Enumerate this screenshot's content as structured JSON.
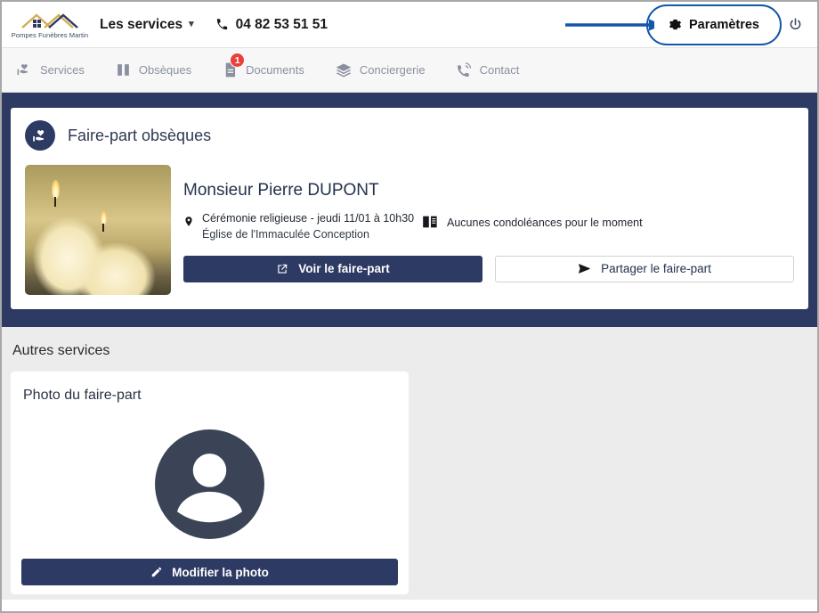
{
  "brand": {
    "logo_icon": "house-roofs-logo-icon",
    "logo_text": "Pompes Funèbres Martin",
    "colors": {
      "navy": "#2d3a63",
      "gold": "#d5ad54",
      "badge_red": "#e8413a",
      "annotation_blue": "#1257a8"
    }
  },
  "header": {
    "services_menu_label": "Les services",
    "chevron_icon": "chevron-down-icon",
    "phone_icon": "phone-icon",
    "phone_number": "04 82 53 51 51",
    "settings_label": "Paramètres",
    "settings_icon": "gear-icon",
    "power_icon": "power-icon",
    "annotation": {
      "arrow_icon": "arrow-right-annotation",
      "highlight": "ellipse-highlight"
    }
  },
  "nav": {
    "items": [
      {
        "label": "Services",
        "icon": "hand-heart-icon",
        "badge": null
      },
      {
        "label": "Obsèques",
        "icon": "open-book-icon",
        "badge": null
      },
      {
        "label": "Documents",
        "icon": "document-icon",
        "badge": "1"
      },
      {
        "label": "Conciergerie",
        "icon": "layers-icon",
        "badge": null
      },
      {
        "label": "Contact",
        "icon": "phone-signal-icon",
        "badge": null
      }
    ]
  },
  "main_card": {
    "icon": "hand-heart-circle-icon",
    "title": "Faire-part obsèques",
    "photo_alt": "candles-photo",
    "deceased_name": "Monsieur Pierre DUPONT",
    "ceremony": {
      "icon": "location-pin-icon",
      "line1": "Cérémonie religieuse - jeudi 11/01 à 10h30",
      "line2": "Église de l'Immaculée Conception"
    },
    "condolences": {
      "icon": "open-book-icon",
      "text": "Aucunes condoléances pour le moment"
    },
    "buttons": {
      "view": {
        "label": "Voir le faire-part",
        "icon": "external-link-icon"
      },
      "share": {
        "label": "Partager le faire-part",
        "icon": "send-icon"
      }
    }
  },
  "other_services": {
    "section_title": "Autres services",
    "cards": [
      {
        "title": "Photo du faire-part",
        "avatar_icon": "person-avatar-placeholder-icon",
        "action": {
          "label": "Modifier la photo",
          "icon": "pencil-icon"
        }
      }
    ]
  }
}
